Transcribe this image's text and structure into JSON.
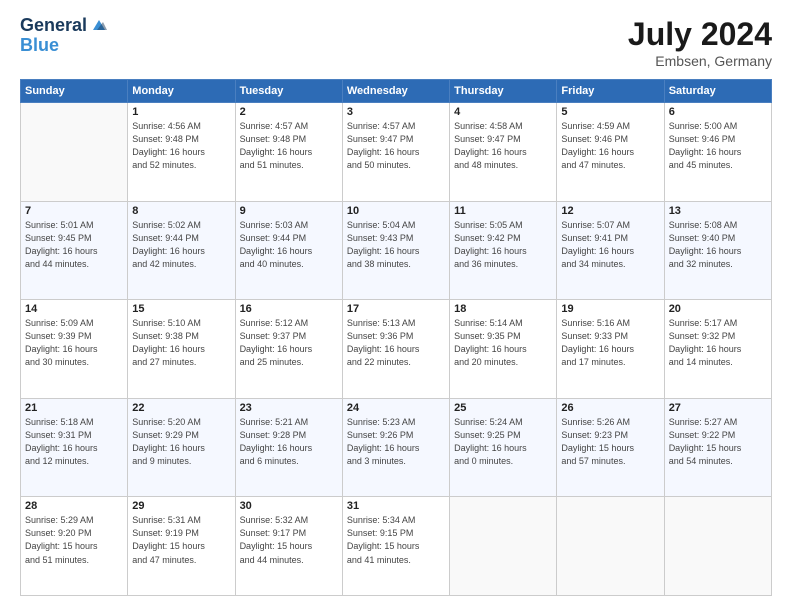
{
  "header": {
    "logo_line1": "General",
    "logo_line2": "Blue",
    "main_title": "July 2024",
    "subtitle": "Embsen, Germany"
  },
  "calendar": {
    "days_of_week": [
      "Sunday",
      "Monday",
      "Tuesday",
      "Wednesday",
      "Thursday",
      "Friday",
      "Saturday"
    ],
    "weeks": [
      [
        {
          "day": "",
          "info": ""
        },
        {
          "day": "1",
          "info": "Sunrise: 4:56 AM\nSunset: 9:48 PM\nDaylight: 16 hours\nand 52 minutes."
        },
        {
          "day": "2",
          "info": "Sunrise: 4:57 AM\nSunset: 9:48 PM\nDaylight: 16 hours\nand 51 minutes."
        },
        {
          "day": "3",
          "info": "Sunrise: 4:57 AM\nSunset: 9:47 PM\nDaylight: 16 hours\nand 50 minutes."
        },
        {
          "day": "4",
          "info": "Sunrise: 4:58 AM\nSunset: 9:47 PM\nDaylight: 16 hours\nand 48 minutes."
        },
        {
          "day": "5",
          "info": "Sunrise: 4:59 AM\nSunset: 9:46 PM\nDaylight: 16 hours\nand 47 minutes."
        },
        {
          "day": "6",
          "info": "Sunrise: 5:00 AM\nSunset: 9:46 PM\nDaylight: 16 hours\nand 45 minutes."
        }
      ],
      [
        {
          "day": "7",
          "info": "Sunrise: 5:01 AM\nSunset: 9:45 PM\nDaylight: 16 hours\nand 44 minutes."
        },
        {
          "day": "8",
          "info": "Sunrise: 5:02 AM\nSunset: 9:44 PM\nDaylight: 16 hours\nand 42 minutes."
        },
        {
          "day": "9",
          "info": "Sunrise: 5:03 AM\nSunset: 9:44 PM\nDaylight: 16 hours\nand 40 minutes."
        },
        {
          "day": "10",
          "info": "Sunrise: 5:04 AM\nSunset: 9:43 PM\nDaylight: 16 hours\nand 38 minutes."
        },
        {
          "day": "11",
          "info": "Sunrise: 5:05 AM\nSunset: 9:42 PM\nDaylight: 16 hours\nand 36 minutes."
        },
        {
          "day": "12",
          "info": "Sunrise: 5:07 AM\nSunset: 9:41 PM\nDaylight: 16 hours\nand 34 minutes."
        },
        {
          "day": "13",
          "info": "Sunrise: 5:08 AM\nSunset: 9:40 PM\nDaylight: 16 hours\nand 32 minutes."
        }
      ],
      [
        {
          "day": "14",
          "info": "Sunrise: 5:09 AM\nSunset: 9:39 PM\nDaylight: 16 hours\nand 30 minutes."
        },
        {
          "day": "15",
          "info": "Sunrise: 5:10 AM\nSunset: 9:38 PM\nDaylight: 16 hours\nand 27 minutes."
        },
        {
          "day": "16",
          "info": "Sunrise: 5:12 AM\nSunset: 9:37 PM\nDaylight: 16 hours\nand 25 minutes."
        },
        {
          "day": "17",
          "info": "Sunrise: 5:13 AM\nSunset: 9:36 PM\nDaylight: 16 hours\nand 22 minutes."
        },
        {
          "day": "18",
          "info": "Sunrise: 5:14 AM\nSunset: 9:35 PM\nDaylight: 16 hours\nand 20 minutes."
        },
        {
          "day": "19",
          "info": "Sunrise: 5:16 AM\nSunset: 9:33 PM\nDaylight: 16 hours\nand 17 minutes."
        },
        {
          "day": "20",
          "info": "Sunrise: 5:17 AM\nSunset: 9:32 PM\nDaylight: 16 hours\nand 14 minutes."
        }
      ],
      [
        {
          "day": "21",
          "info": "Sunrise: 5:18 AM\nSunset: 9:31 PM\nDaylight: 16 hours\nand 12 minutes."
        },
        {
          "day": "22",
          "info": "Sunrise: 5:20 AM\nSunset: 9:29 PM\nDaylight: 16 hours\nand 9 minutes."
        },
        {
          "day": "23",
          "info": "Sunrise: 5:21 AM\nSunset: 9:28 PM\nDaylight: 16 hours\nand 6 minutes."
        },
        {
          "day": "24",
          "info": "Sunrise: 5:23 AM\nSunset: 9:26 PM\nDaylight: 16 hours\nand 3 minutes."
        },
        {
          "day": "25",
          "info": "Sunrise: 5:24 AM\nSunset: 9:25 PM\nDaylight: 16 hours\nand 0 minutes."
        },
        {
          "day": "26",
          "info": "Sunrise: 5:26 AM\nSunset: 9:23 PM\nDaylight: 15 hours\nand 57 minutes."
        },
        {
          "day": "27",
          "info": "Sunrise: 5:27 AM\nSunset: 9:22 PM\nDaylight: 15 hours\nand 54 minutes."
        }
      ],
      [
        {
          "day": "28",
          "info": "Sunrise: 5:29 AM\nSunset: 9:20 PM\nDaylight: 15 hours\nand 51 minutes."
        },
        {
          "day": "29",
          "info": "Sunrise: 5:31 AM\nSunset: 9:19 PM\nDaylight: 15 hours\nand 47 minutes."
        },
        {
          "day": "30",
          "info": "Sunrise: 5:32 AM\nSunset: 9:17 PM\nDaylight: 15 hours\nand 44 minutes."
        },
        {
          "day": "31",
          "info": "Sunrise: 5:34 AM\nSunset: 9:15 PM\nDaylight: 15 hours\nand 41 minutes."
        },
        {
          "day": "",
          "info": ""
        },
        {
          "day": "",
          "info": ""
        },
        {
          "day": "",
          "info": ""
        }
      ]
    ]
  }
}
